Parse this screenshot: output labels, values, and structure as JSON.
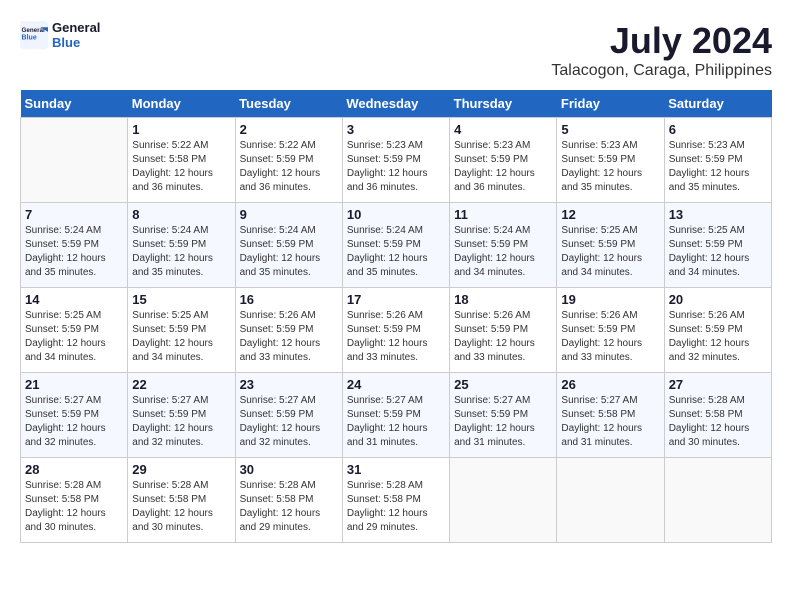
{
  "header": {
    "logo_general": "General",
    "logo_blue": "Blue",
    "month_title": "July 2024",
    "location": "Talacogon, Caraga, Philippines"
  },
  "weekdays": [
    "Sunday",
    "Monday",
    "Tuesday",
    "Wednesday",
    "Thursday",
    "Friday",
    "Saturday"
  ],
  "weeks": [
    [
      {
        "day": "",
        "info": ""
      },
      {
        "day": "1",
        "info": "Sunrise: 5:22 AM\nSunset: 5:58 PM\nDaylight: 12 hours\nand 36 minutes."
      },
      {
        "day": "2",
        "info": "Sunrise: 5:22 AM\nSunset: 5:59 PM\nDaylight: 12 hours\nand 36 minutes."
      },
      {
        "day": "3",
        "info": "Sunrise: 5:23 AM\nSunset: 5:59 PM\nDaylight: 12 hours\nand 36 minutes."
      },
      {
        "day": "4",
        "info": "Sunrise: 5:23 AM\nSunset: 5:59 PM\nDaylight: 12 hours\nand 36 minutes."
      },
      {
        "day": "5",
        "info": "Sunrise: 5:23 AM\nSunset: 5:59 PM\nDaylight: 12 hours\nand 35 minutes."
      },
      {
        "day": "6",
        "info": "Sunrise: 5:23 AM\nSunset: 5:59 PM\nDaylight: 12 hours\nand 35 minutes."
      }
    ],
    [
      {
        "day": "7",
        "info": "Sunrise: 5:24 AM\nSunset: 5:59 PM\nDaylight: 12 hours\nand 35 minutes."
      },
      {
        "day": "8",
        "info": "Sunrise: 5:24 AM\nSunset: 5:59 PM\nDaylight: 12 hours\nand 35 minutes."
      },
      {
        "day": "9",
        "info": "Sunrise: 5:24 AM\nSunset: 5:59 PM\nDaylight: 12 hours\nand 35 minutes."
      },
      {
        "day": "10",
        "info": "Sunrise: 5:24 AM\nSunset: 5:59 PM\nDaylight: 12 hours\nand 35 minutes."
      },
      {
        "day": "11",
        "info": "Sunrise: 5:24 AM\nSunset: 5:59 PM\nDaylight: 12 hours\nand 34 minutes."
      },
      {
        "day": "12",
        "info": "Sunrise: 5:25 AM\nSunset: 5:59 PM\nDaylight: 12 hours\nand 34 minutes."
      },
      {
        "day": "13",
        "info": "Sunrise: 5:25 AM\nSunset: 5:59 PM\nDaylight: 12 hours\nand 34 minutes."
      }
    ],
    [
      {
        "day": "14",
        "info": "Sunrise: 5:25 AM\nSunset: 5:59 PM\nDaylight: 12 hours\nand 34 minutes."
      },
      {
        "day": "15",
        "info": "Sunrise: 5:25 AM\nSunset: 5:59 PM\nDaylight: 12 hours\nand 34 minutes."
      },
      {
        "day": "16",
        "info": "Sunrise: 5:26 AM\nSunset: 5:59 PM\nDaylight: 12 hours\nand 33 minutes."
      },
      {
        "day": "17",
        "info": "Sunrise: 5:26 AM\nSunset: 5:59 PM\nDaylight: 12 hours\nand 33 minutes."
      },
      {
        "day": "18",
        "info": "Sunrise: 5:26 AM\nSunset: 5:59 PM\nDaylight: 12 hours\nand 33 minutes."
      },
      {
        "day": "19",
        "info": "Sunrise: 5:26 AM\nSunset: 5:59 PM\nDaylight: 12 hours\nand 33 minutes."
      },
      {
        "day": "20",
        "info": "Sunrise: 5:26 AM\nSunset: 5:59 PM\nDaylight: 12 hours\nand 32 minutes."
      }
    ],
    [
      {
        "day": "21",
        "info": "Sunrise: 5:27 AM\nSunset: 5:59 PM\nDaylight: 12 hours\nand 32 minutes."
      },
      {
        "day": "22",
        "info": "Sunrise: 5:27 AM\nSunset: 5:59 PM\nDaylight: 12 hours\nand 32 minutes."
      },
      {
        "day": "23",
        "info": "Sunrise: 5:27 AM\nSunset: 5:59 PM\nDaylight: 12 hours\nand 32 minutes."
      },
      {
        "day": "24",
        "info": "Sunrise: 5:27 AM\nSunset: 5:59 PM\nDaylight: 12 hours\nand 31 minutes."
      },
      {
        "day": "25",
        "info": "Sunrise: 5:27 AM\nSunset: 5:59 PM\nDaylight: 12 hours\nand 31 minutes."
      },
      {
        "day": "26",
        "info": "Sunrise: 5:27 AM\nSunset: 5:58 PM\nDaylight: 12 hours\nand 31 minutes."
      },
      {
        "day": "27",
        "info": "Sunrise: 5:28 AM\nSunset: 5:58 PM\nDaylight: 12 hours\nand 30 minutes."
      }
    ],
    [
      {
        "day": "28",
        "info": "Sunrise: 5:28 AM\nSunset: 5:58 PM\nDaylight: 12 hours\nand 30 minutes."
      },
      {
        "day": "29",
        "info": "Sunrise: 5:28 AM\nSunset: 5:58 PM\nDaylight: 12 hours\nand 30 minutes."
      },
      {
        "day": "30",
        "info": "Sunrise: 5:28 AM\nSunset: 5:58 PM\nDaylight: 12 hours\nand 29 minutes."
      },
      {
        "day": "31",
        "info": "Sunrise: 5:28 AM\nSunset: 5:58 PM\nDaylight: 12 hours\nand 29 minutes."
      },
      {
        "day": "",
        "info": ""
      },
      {
        "day": "",
        "info": ""
      },
      {
        "day": "",
        "info": ""
      }
    ]
  ]
}
